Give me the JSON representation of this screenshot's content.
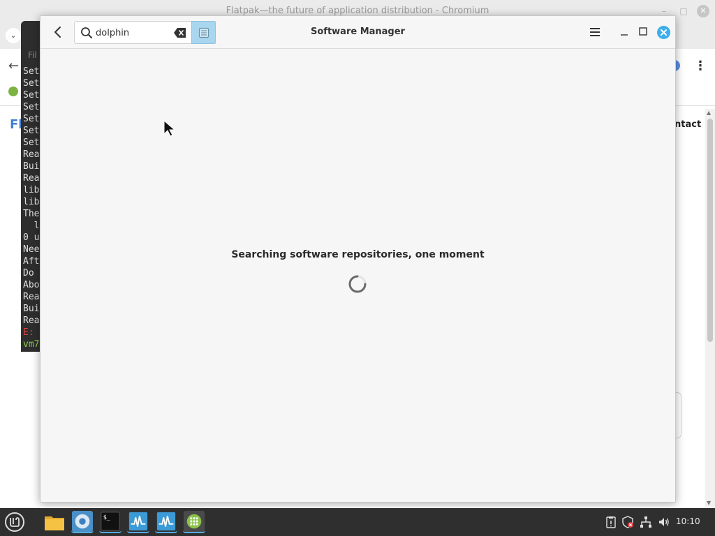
{
  "browser": {
    "title": "Flatpak—the future of application distribution - Chromium",
    "page_heading": "Fl",
    "nav_contact": "ntact"
  },
  "terminal": {
    "menu_label": "Fil",
    "lines": [
      "Set",
      "Set",
      "Set",
      "Set",
      "Set",
      "Set",
      "Set",
      "Rea",
      "Bui",
      "Rea",
      "lib",
      "lib",
      "The",
      "  l",
      "0 u",
      "Nee",
      "Aft",
      "Do ",
      "Abo",
      "Rea",
      "Bui",
      "Rea"
    ],
    "error_line": "E:",
    "prompt_line": "vm7"
  },
  "software_manager": {
    "title": "Software Manager",
    "search": {
      "value": "dolphin",
      "placeholder": ""
    },
    "status_message": "Searching software repositories, one moment"
  },
  "taskbar": {
    "clock": "10:10",
    "terminal_glyph": "$_"
  },
  "colors": {
    "accent": "#3daee9",
    "search_button": "#a9d6ef",
    "taskbar": "#2f2f2f",
    "mint_green": "#8bc34a"
  }
}
